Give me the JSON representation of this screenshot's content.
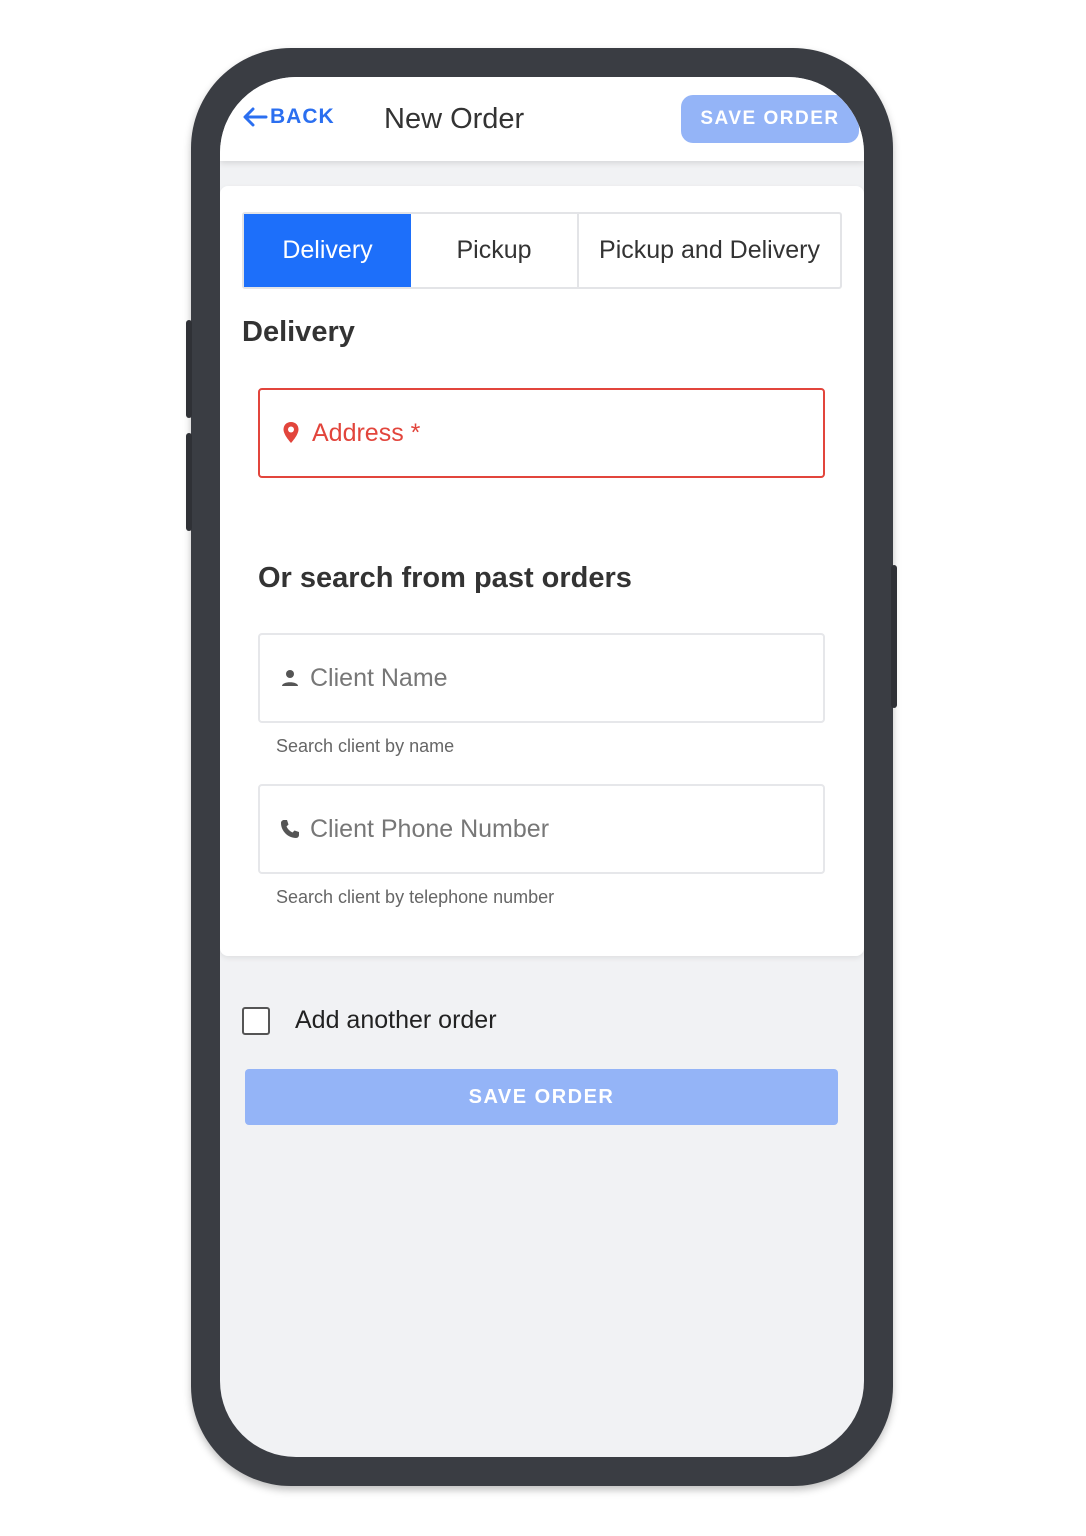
{
  "header": {
    "back_label": "BACK",
    "title": "New Order",
    "save_label": "SAVE ORDER"
  },
  "tabs": [
    {
      "label": "Delivery",
      "selected": true
    },
    {
      "label": "Pickup",
      "selected": false
    },
    {
      "label": "Pickup and Delivery",
      "selected": false
    }
  ],
  "form": {
    "section_title": "Delivery",
    "address_placeholder": "Address *",
    "search_title": "Or search from past orders",
    "client_name_placeholder": "Client Name",
    "client_name_helper": "Search client by name",
    "client_phone_placeholder": "Client Phone Number",
    "client_phone_helper": "Search client by telephone number"
  },
  "footer": {
    "add_another_label": "Add another order",
    "add_another_checked": false,
    "save_label": "SAVE ORDER"
  },
  "colors": {
    "accent": "#1d6ffa",
    "disabled_button": "#94b4f7",
    "error": "#e2453c"
  },
  "icons": {
    "back": "arrow-left-icon",
    "address": "location-pin-icon",
    "client_name": "person-icon",
    "client_phone": "phone-icon"
  }
}
